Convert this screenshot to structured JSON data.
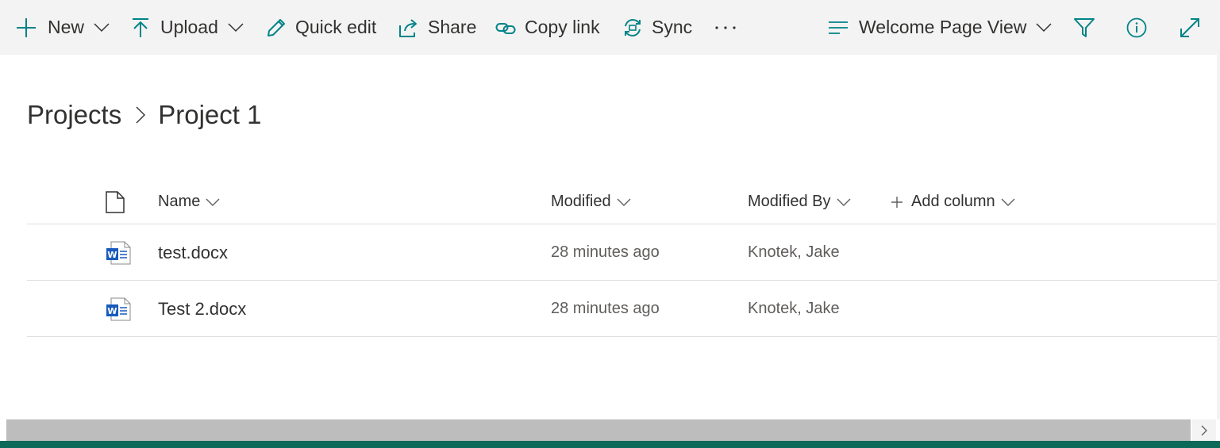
{
  "colors": {
    "accent": "#038387",
    "command_bar_bg": "#f3f3f3",
    "text": "#323130",
    "secondary_text": "#605e5c",
    "word_blue": "#185abd",
    "bottom_bar": "#0b6a5a"
  },
  "command_bar": {
    "new": {
      "label": "New",
      "icon": "plus-icon"
    },
    "upload": {
      "label": "Upload",
      "icon": "upload-arrow-icon"
    },
    "quick_edit": {
      "label": "Quick edit",
      "icon": "pencil-icon"
    },
    "share": {
      "label": "Share",
      "icon": "share-icon"
    },
    "copy_link": {
      "label": "Copy link",
      "icon": "link-icon"
    },
    "sync": {
      "label": "Sync",
      "icon": "sync-icon"
    },
    "more": {
      "label": "···",
      "icon": "more-icon"
    },
    "view": {
      "label": "Welcome Page View",
      "icon": "view-lines-icon"
    },
    "filter_icon": "filter-icon",
    "info_icon": "info-icon",
    "expand_icon": "expand-icon"
  },
  "breadcrumb": {
    "items": [
      "Projects",
      "Project 1"
    ]
  },
  "list": {
    "columns": {
      "type_icon": "file-icon",
      "name": "Name",
      "modified": "Modified",
      "modified_by": "Modified By",
      "add_column": "Add column"
    },
    "rows": [
      {
        "icon": "word-doc-icon",
        "name": "test.docx",
        "modified": "28 minutes ago",
        "modified_by": "Knotek, Jake"
      },
      {
        "icon": "word-doc-icon",
        "name": "Test 2.docx",
        "modified": "28 minutes ago",
        "modified_by": "Knotek, Jake"
      }
    ]
  }
}
